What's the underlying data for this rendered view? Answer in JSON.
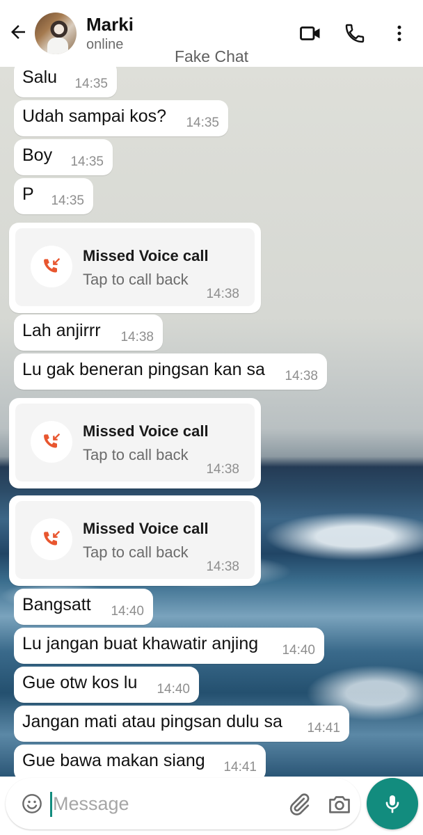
{
  "header": {
    "contact_name": "Marki",
    "status": "online",
    "watermark": "Fake Chat",
    "icons": {
      "back": "arrow-left-icon",
      "video": "video-camera-icon",
      "call": "phone-icon",
      "more": "more-vertical-icon"
    }
  },
  "messages": [
    {
      "type": "text",
      "text": "Salu",
      "time": "14:35"
    },
    {
      "type": "text",
      "text": "Udah sampai kos?",
      "time": "14:35"
    },
    {
      "type": "text",
      "text": "Boy",
      "time": "14:35"
    },
    {
      "type": "text",
      "text": "P",
      "time": "14:35"
    },
    {
      "type": "missed_call",
      "title": "Missed Voice call",
      "subtitle": "Tap to call back",
      "time": "14:38"
    },
    {
      "type": "text",
      "text": "Lah anjirrr",
      "time": "14:38"
    },
    {
      "type": "text",
      "text": "Lu gak beneran pingsan kan sa",
      "time": "14:38"
    },
    {
      "type": "missed_call",
      "title": "Missed Voice call",
      "subtitle": "Tap to call back",
      "time": "14:38"
    },
    {
      "type": "missed_call",
      "title": "Missed Voice call",
      "subtitle": "Tap to call back",
      "time": "14:38"
    },
    {
      "type": "text",
      "text": "Bangsatt",
      "time": "14:40"
    },
    {
      "type": "text",
      "text": "Lu jangan buat khawatir anjing",
      "time": "14:40"
    },
    {
      "type": "text",
      "text": "Gue otw kos lu",
      "time": "14:40"
    },
    {
      "type": "text",
      "text": "Jangan mati atau pingsan dulu sa",
      "time": "14:41"
    },
    {
      "type": "text",
      "text": "Gue bawa makan siang",
      "time": "14:41"
    }
  ],
  "input": {
    "placeholder": "Message",
    "icons": {
      "emoji": "emoji-icon",
      "attach": "paperclip-icon",
      "camera": "camera-icon",
      "mic": "microphone-icon"
    }
  },
  "colors": {
    "accent": "#128c7e",
    "missed_call": "#e8562f",
    "bubble": "#ffffff",
    "timestamp": "#8e8e8e"
  }
}
